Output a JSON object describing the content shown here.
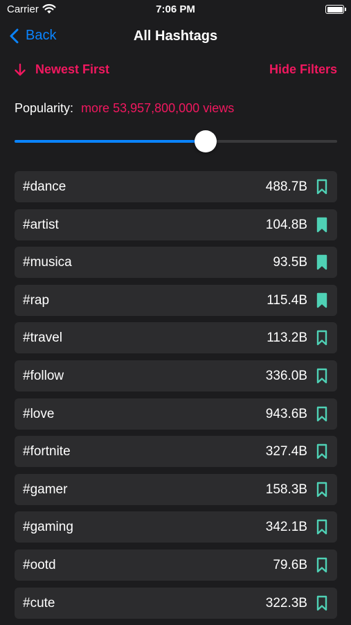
{
  "statusbar": {
    "carrier": "Carrier",
    "time": "7:06 PM"
  },
  "nav": {
    "back_label": "Back",
    "title": "All Hashtags"
  },
  "filters": {
    "sort_label": "Newest First",
    "hide_filters_label": "Hide Filters",
    "popularity_label": "Popularity:",
    "popularity_value": "more 53,957,800,000 views",
    "slider_fraction": 0.593
  },
  "colors": {
    "accent": "#f0185f",
    "blue": "#0a84ff",
    "teal": "#4fd1b5",
    "row_bg": "#2c2c2e"
  },
  "hashtags": [
    {
      "tag": "#dance",
      "count": "488.7B",
      "saved": false
    },
    {
      "tag": "#artist",
      "count": "104.8B",
      "saved": true
    },
    {
      "tag": "#musica",
      "count": "93.5B",
      "saved": true
    },
    {
      "tag": "#rap",
      "count": "115.4B",
      "saved": true
    },
    {
      "tag": "#travel",
      "count": "113.2B",
      "saved": false
    },
    {
      "tag": "#follow",
      "count": "336.0B",
      "saved": false
    },
    {
      "tag": "#love",
      "count": "943.6B",
      "saved": false
    },
    {
      "tag": "#fortnite",
      "count": "327.4B",
      "saved": false
    },
    {
      "tag": "#gamer",
      "count": "158.3B",
      "saved": false
    },
    {
      "tag": "#gaming",
      "count": "342.1B",
      "saved": false
    },
    {
      "tag": "#ootd",
      "count": "79.6B",
      "saved": false
    },
    {
      "tag": "#cute",
      "count": "322.3B",
      "saved": false
    }
  ]
}
